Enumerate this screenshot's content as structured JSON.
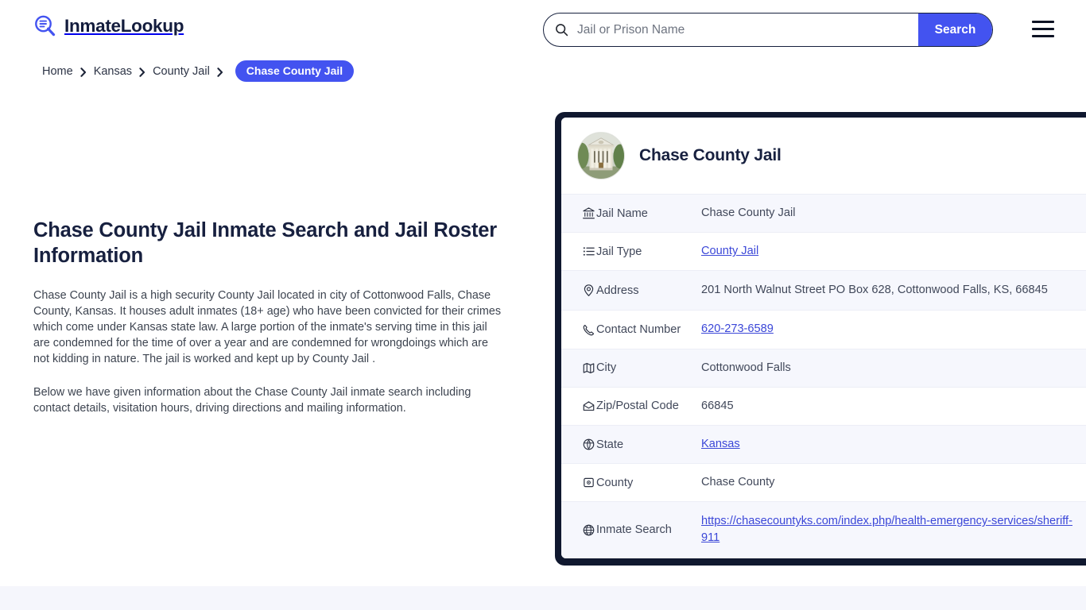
{
  "header": {
    "logo_text": "InmateLookup",
    "logo_icon": "magnifier-list-icon",
    "menu_icon": "hamburger-menu-icon"
  },
  "search": {
    "icon": "search-icon",
    "placeholder": "Jail or Prison Name",
    "value": "",
    "button_label": "Search",
    "button_color": "#4353f0"
  },
  "breadcrumb": {
    "items": [
      {
        "label": "Home"
      },
      {
        "label": "Kansas"
      },
      {
        "label": "County Jail"
      }
    ],
    "current": "Chase County Jail",
    "separator_icon": "chevron-right-icon"
  },
  "main": {
    "title": "Chase County Jail Inmate Search and Jail Roster Information",
    "paragraphs": [
      "Chase County Jail is a high security County Jail located in city of Cottonwood Falls, Chase County, Kansas. It houses adult inmates (18+ age) who have been convicted for their crimes which come under Kansas state law. A large portion of the inmate's serving time in this jail are condemned for the time of over a year and are condemned for wrongdoings which are not kidding in nature. The jail is worked and kept up by County Jail .",
      "Below we have given information about the Chase County Jail inmate search including contact details, visitation hours, driving directions and mailing information."
    ]
  },
  "card": {
    "title": "Chase County Jail",
    "avatar_icon": "courthouse-photo",
    "border_color": "#10182f",
    "rows": [
      {
        "icon": "bank-icon",
        "label": "Jail Name",
        "value": "Chase County Jail",
        "link": false
      },
      {
        "icon": "list-icon",
        "label": "Jail Type",
        "value": "County Jail",
        "link": true
      },
      {
        "icon": "map-pin-icon",
        "label": "Address",
        "value": "201 North Walnut Street PO Box 628, Cottonwood Falls, KS, 66845",
        "link": false
      },
      {
        "icon": "phone-icon",
        "label": "Contact Number",
        "value": "620-273-6589",
        "link": true
      },
      {
        "icon": "map-icon",
        "label": "City",
        "value": "Cottonwood Falls",
        "link": false
      },
      {
        "icon": "envelope-icon",
        "label": "Zip/Postal Code",
        "value": "66845",
        "link": false
      },
      {
        "icon": "compass-icon",
        "label": "State",
        "value": "Kansas",
        "link": true
      },
      {
        "icon": "county-icon",
        "label": "County",
        "value": "Chase County",
        "link": false
      },
      {
        "icon": "globe-icon",
        "label": "Inmate Search",
        "value": "https://chasecountyks.com/index.php/health-emergency-services/sheriff-911",
        "link": true
      }
    ]
  }
}
